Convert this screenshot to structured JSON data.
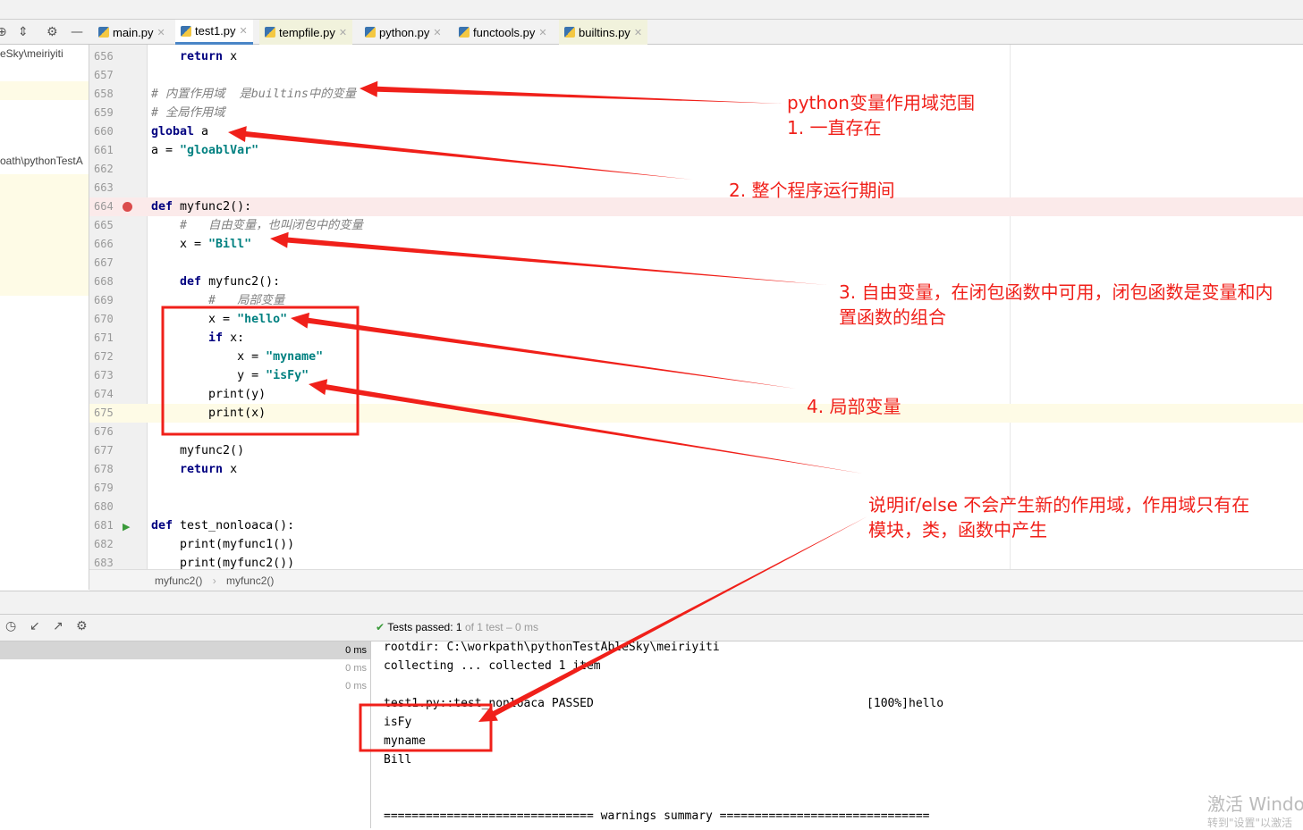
{
  "tabs": [
    {
      "label": "main.py",
      "active": false,
      "hl": false
    },
    {
      "label": "test1.py",
      "active": true,
      "hl": false
    },
    {
      "label": "tempfile.py",
      "active": false,
      "hl": true
    },
    {
      "label": "python.py",
      "active": false,
      "hl": false
    },
    {
      "label": "functools.py",
      "active": false,
      "hl": false
    },
    {
      "label": "builtins.py",
      "active": false,
      "hl": true
    }
  ],
  "left_panel": {
    "path1": "eSky\\meiriyiti",
    "path2": "oath\\pythonTestA"
  },
  "editor": {
    "lines": [
      {
        "n": "656",
        "seg": [
          [
            "pl",
            "    "
          ],
          [
            "kw",
            "return"
          ],
          [
            "pl",
            " x"
          ]
        ]
      },
      {
        "n": "657",
        "seg": []
      },
      {
        "n": "658",
        "seg": [
          [
            "cm",
            "# 内置作用域  是builtins中的变量"
          ]
        ]
      },
      {
        "n": "659",
        "seg": [
          [
            "cm",
            "# 全局作用域"
          ]
        ]
      },
      {
        "n": "660",
        "seg": [
          [
            "kw",
            "global"
          ],
          [
            "pl",
            " a"
          ]
        ]
      },
      {
        "n": "661",
        "seg": [
          [
            "pl",
            "a = "
          ],
          [
            "str",
            "\"gloablVar\""
          ]
        ]
      },
      {
        "n": "662",
        "seg": []
      },
      {
        "n": "663",
        "seg": []
      },
      {
        "n": "664",
        "seg": [
          [
            "kw",
            "def"
          ],
          [
            "pl",
            " myfunc2():"
          ]
        ],
        "breakpoint": true
      },
      {
        "n": "665",
        "seg": [
          [
            "pl",
            "    "
          ],
          [
            "cm",
            "#   自由变量，也叫闭包中的变量"
          ]
        ]
      },
      {
        "n": "666",
        "seg": [
          [
            "pl",
            "    x = "
          ],
          [
            "str",
            "\"Bill\""
          ]
        ]
      },
      {
        "n": "667",
        "seg": []
      },
      {
        "n": "668",
        "seg": [
          [
            "pl",
            "    "
          ],
          [
            "kw",
            "def"
          ],
          [
            "pl",
            " myfunc2():"
          ]
        ]
      },
      {
        "n": "669",
        "seg": [
          [
            "pl",
            "        "
          ],
          [
            "cm",
            "#   局部变量"
          ]
        ]
      },
      {
        "n": "670",
        "seg": [
          [
            "pl",
            "        x = "
          ],
          [
            "str",
            "\"hello\""
          ]
        ]
      },
      {
        "n": "671",
        "seg": [
          [
            "pl",
            "        "
          ],
          [
            "kw",
            "if"
          ],
          [
            "pl",
            " x:"
          ]
        ]
      },
      {
        "n": "672",
        "seg": [
          [
            "pl",
            "            x = "
          ],
          [
            "str",
            "\"myname\""
          ]
        ]
      },
      {
        "n": "673",
        "seg": [
          [
            "pl",
            "            y = "
          ],
          [
            "str",
            "\"isFy\""
          ]
        ]
      },
      {
        "n": "674",
        "seg": [
          [
            "pl",
            "        print(y)"
          ]
        ]
      },
      {
        "n": "675",
        "seg": [
          [
            "pl",
            "        print(x)"
          ]
        ],
        "current": true
      },
      {
        "n": "676",
        "seg": []
      },
      {
        "n": "677",
        "seg": [
          [
            "pl",
            "    myfunc2()"
          ]
        ]
      },
      {
        "n": "678",
        "seg": [
          [
            "pl",
            "    "
          ],
          [
            "kw",
            "return"
          ],
          [
            "pl",
            " x"
          ]
        ]
      },
      {
        "n": "679",
        "seg": []
      },
      {
        "n": "680",
        "seg": []
      },
      {
        "n": "681",
        "seg": [
          [
            "kw",
            "def"
          ],
          [
            "pl",
            " test_nonloaca():"
          ]
        ],
        "run": true
      },
      {
        "n": "682",
        "seg": [
          [
            "pl",
            "    print(myfunc1())"
          ]
        ]
      },
      {
        "n": "683",
        "seg": [
          [
            "pl",
            "    print(myfunc2())"
          ]
        ]
      }
    ]
  },
  "breadcrumb": {
    "item1": "myfunc2()",
    "sep": "›",
    "item2": "myfunc2()"
  },
  "run": {
    "status_prefix": "Tests passed:",
    "passed": "1",
    "of_text": "of 1 test – 0 ms"
  },
  "tree": {
    "times": [
      "0 ms",
      "0 ms",
      "0 ms"
    ]
  },
  "console": {
    "lines": [
      "rootdir: C:\\workpath\\pythonTestAbleSky\\meiriyiti",
      "collecting ... collected 1 item",
      "",
      "test1.py::test_nonloaca PASSED                                       [100%]hello",
      "isFy",
      "myname",
      "Bill",
      "",
      "",
      "============================== warnings summary =============================="
    ]
  },
  "annotations": {
    "a1_line1": "python变量作用域范围",
    "a1_line2": "1. 一直存在",
    "a2": "2. 整个程序运行期间",
    "a3_line1": "3. 自由变量，在闭包函数中可用，闭包函数是变量和内",
    "a3_line2": "置函数的组合",
    "a4": "4. 局部变量",
    "a5_line1": "说明if/else 不会产生新的作用域，作用域只有在",
    "a5_line2": "模块，类，函数中产生",
    "color": "#f0201a"
  },
  "watermark": {
    "line1": "激活 Windo",
    "line2": "转到\"设置\"以激活"
  }
}
